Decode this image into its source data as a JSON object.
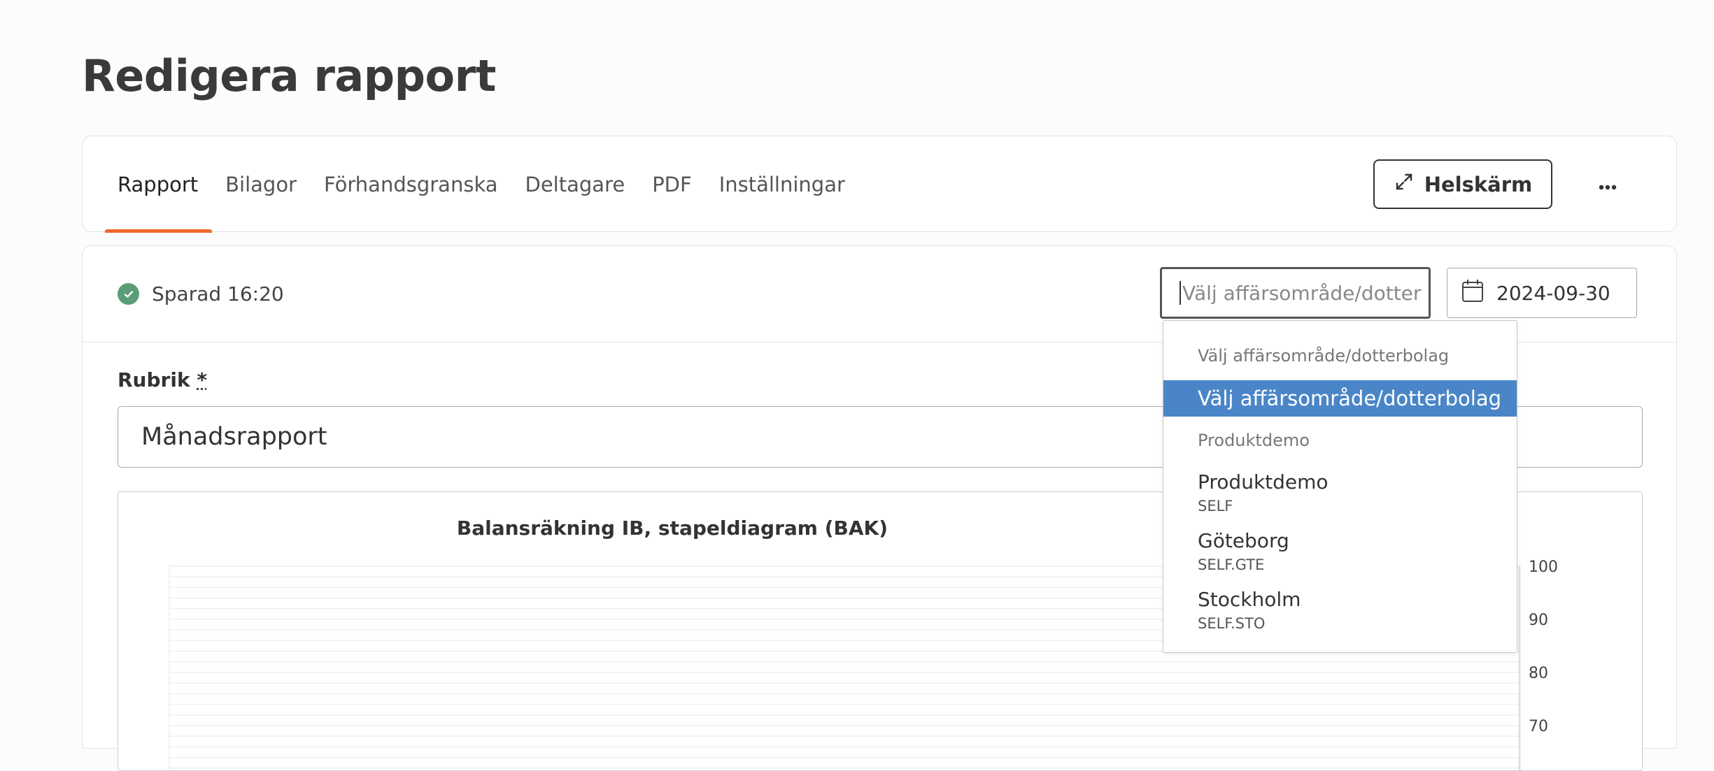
{
  "page": {
    "title": "Redigera rapport"
  },
  "tabs": [
    {
      "label": "Rapport",
      "active": true
    },
    {
      "label": "Bilagor",
      "active": false
    },
    {
      "label": "Förhandsgranska",
      "active": false
    },
    {
      "label": "Deltagare",
      "active": false
    },
    {
      "label": "PDF",
      "active": false
    },
    {
      "label": "Inställningar",
      "active": false
    }
  ],
  "toolbar": {
    "fullscreen_label": "Helskärm",
    "more_label": "···"
  },
  "status": {
    "saved_text": "Sparad 16:20"
  },
  "company_select": {
    "placeholder": "Välj affärsområde/dotter"
  },
  "date_picker": {
    "value": "2024-09-30"
  },
  "form": {
    "rubrik_label": "Rubrik",
    "required_mark": "*",
    "rubrik_value": "Månadsrapport"
  },
  "dropdown": {
    "group1_label": "Välj affärsområde/dotterbolag",
    "selected_option": "Välj affärsområde/dotterbolag",
    "group2_label": "Produktdemo",
    "items": [
      {
        "name": "Produktdemo",
        "code": "SELF"
      },
      {
        "name": "Göteborg",
        "code": "SELF.GTE"
      },
      {
        "name": "Stockholm",
        "code": "SELF.STO"
      }
    ]
  },
  "accent_color": "#ee6a2d",
  "highlight_color": "#4a86c7",
  "success_color": "#5a9e78",
  "chart_data": {
    "type": "bar",
    "title": "Balansräkning IB, stapeldiagram (BAK)",
    "y_axis_position": "right",
    "ylim": [
      70,
      100
    ],
    "ytick_labels": [
      "100",
      "90",
      "80",
      "70"
    ],
    "grid": true,
    "categories": [],
    "values": []
  }
}
